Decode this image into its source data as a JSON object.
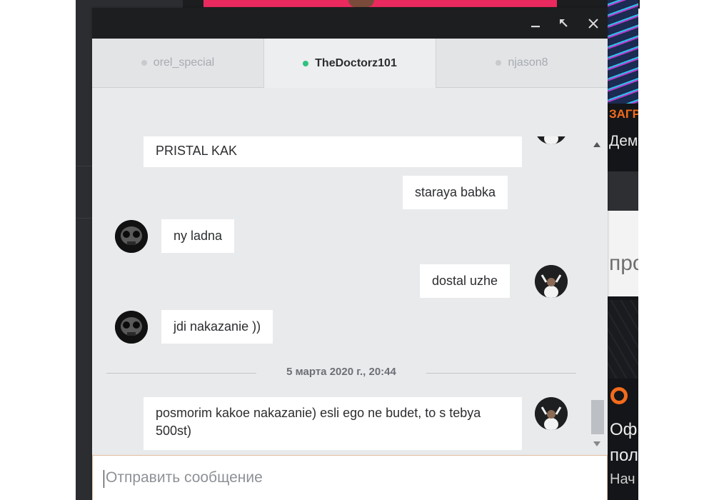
{
  "background": {
    "orange_text": "ЗАГР",
    "heading_text": "Дем",
    "light_text": "про",
    "title_line1": "Оф",
    "title_line2": "пол",
    "title_line3": "Нач"
  },
  "window": {
    "controls": [
      "minimize",
      "restore",
      "close"
    ]
  },
  "tabs": [
    {
      "label": "orel_special",
      "active": false,
      "online": false
    },
    {
      "label": "TheDoctorz101",
      "active": true,
      "online": true
    },
    {
      "label": "njason8",
      "active": false,
      "online": false
    }
  ],
  "messages": [
    {
      "from": "other",
      "text": "PRISTAL KAK"
    },
    {
      "from": "self",
      "text": "staraya babka"
    },
    {
      "from": "other",
      "text": "ny ladna"
    },
    {
      "from": "self",
      "text": "dostal uzhe"
    },
    {
      "from": "other",
      "text": "jdi nakazanie ))"
    },
    {
      "from": "self",
      "text": "posmorim kakoe nakazanie) esli ego ne budet, to s tebya 500st)"
    }
  ],
  "date_separator": "5 марта 2020 г., 20:44",
  "composer": {
    "placeholder": "Отправить сообщение",
    "value": ""
  },
  "colors": {
    "online_dot": "#2ec27e",
    "titlebar": "#1d1e20",
    "chat_bg": "#e8eaec",
    "bubble": "#ffffff"
  }
}
